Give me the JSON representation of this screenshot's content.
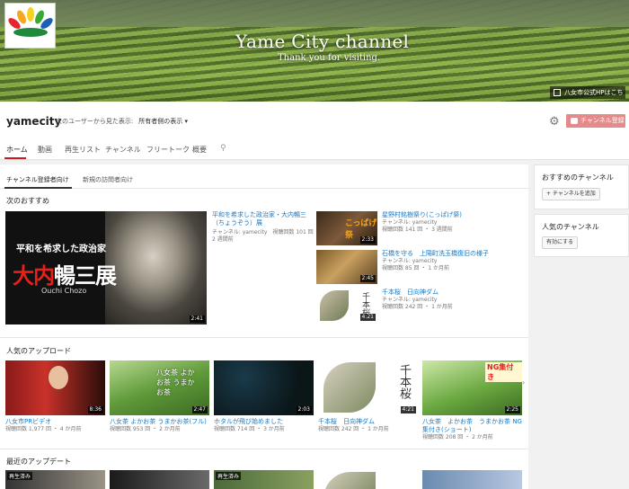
{
  "banner": {
    "title": "Yame City channel",
    "subtitle": "Thank you for visiting.",
    "link": "八女市公式HPはこちら"
  },
  "header": {
    "channel_name": "yamecity",
    "view_as_label": "次のユーザーから見た表示:",
    "view_as_value": "所有者側の表示 ▾",
    "subscribe_label": "チャンネル登録"
  },
  "tabs": [
    "ホーム",
    "動画",
    "再生リスト",
    "チャンネル",
    "フリートーク",
    "概要"
  ],
  "subtabs": [
    "チャンネル登録者向け",
    "新規の訪問者向け"
  ],
  "featured": {
    "section_title": "次のおすすめ",
    "main": {
      "poster_line1": "平和を希求した政治家",
      "poster_red": "大内",
      "poster_white": "暢三展",
      "poster_name": "Ouchi Chozo",
      "duration": "2:41",
      "title": "平和を希求した政治家・大内暢三（ちょうぞう）展",
      "channel": "チャンネル: yamecity",
      "views": "視聴回数 101 回",
      "age": "2 週間前"
    },
    "list": [
      {
        "title": "星野村銘樹祭り(こっぱげ祭)",
        "channel": "チャンネル: yamecity",
        "meta": "視聴回数 141 回 ・ 3 週間前",
        "duration": "2:33",
        "thumb_text": "こっぱげ祭"
      },
      {
        "title": "石橋を守る　上陽町洗玉橋復旧の様子",
        "channel": "チャンネル: yamecity",
        "meta": "視聴回数 85 回 ・ 1 か月前",
        "duration": "2:45",
        "thumb_text": ""
      },
      {
        "title": "千本桜　日向神ダム",
        "channel": "チャンネル: yamecity",
        "meta": "視聴回数 242 回 ・ 1 か月前",
        "duration": "4:21",
        "thumb_text": "千本桜"
      }
    ]
  },
  "popular": {
    "section_title": "人気のアップロード",
    "videos": [
      {
        "title": "八女市PRビデオ",
        "meta": "視聴回数 1,977 回 ・ 4 か月前",
        "duration": "8:36",
        "thumb_text": ""
      },
      {
        "title": "八女茶 よかお茶 うまかお茶(フル)",
        "meta": "視聴回数 953 回 ・ 2 か月前",
        "duration": "2:47",
        "thumb_text": "八女茶 よかお茶 うまかお茶"
      },
      {
        "title": "ホタルが飛び始めました",
        "meta": "視聴回数 714 回 ・ 3 か月前",
        "duration": "2:03",
        "thumb_text": ""
      },
      {
        "title": "千本桜　日向神ダム",
        "meta": "視聴回数 242 回 ・ 1 か月前",
        "duration": "4:21",
        "thumb_text": "千本桜"
      },
      {
        "title": "八女茶　よかお茶　うまかお茶 NG集付き(ショート)",
        "meta": "視聴回数 208 回 ・ 2 か月前",
        "duration": "2:25",
        "thumb_text": "NG集付き"
      }
    ]
  },
  "recent": {
    "section_title": "最近のアップデート",
    "badge": "再生済み"
  },
  "sidebar": {
    "recommended_title": "おすすめのチャンネル",
    "add_channel_label": "+ チャンネルを追加",
    "popular_title": "人気のチャンネル",
    "enable_label": "有効にする"
  },
  "colors": {
    "accent": "#cc181e",
    "link": "#167ac6",
    "subscribe": "#e58a8a"
  }
}
